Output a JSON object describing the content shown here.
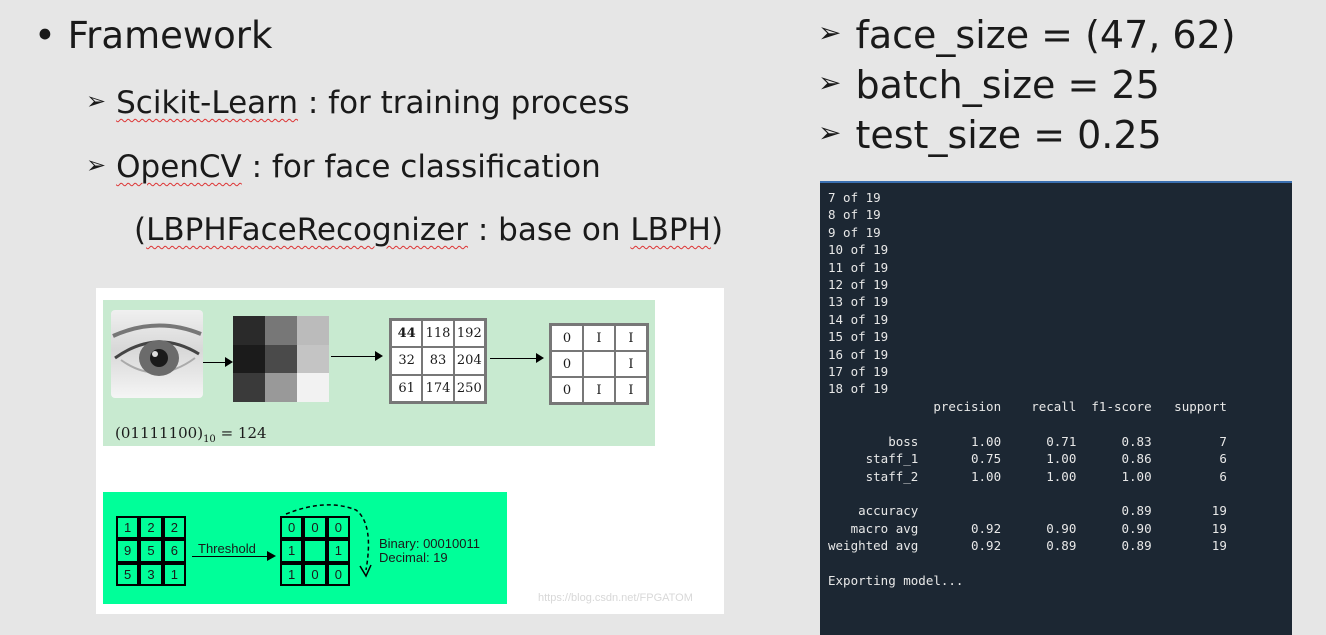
{
  "left": {
    "heading": "Framework",
    "bullet": "•",
    "arrow": "➢",
    "item1_link": "Scikit-Learn",
    "item1_rest": " : for training process",
    "item2_link": "OpenCV",
    "item2_rest": " : for face classification",
    "item3_open": "(",
    "item3_link": "LBPHFaceRecognizer",
    "item3_mid": " : base on ",
    "item3_link2": "LBPH",
    "item3_close": ")"
  },
  "params": [
    "face_size = (47, 62)",
    "batch_size = 25",
    "test_size = 0.25"
  ],
  "lbp_figure": {
    "matrix": [
      "44",
      "118",
      "192",
      "32",
      "83",
      "204",
      "61",
      "174",
      "250"
    ],
    "binary": [
      "0",
      "I",
      "I",
      "0",
      "",
      "I",
      "0",
      "I",
      "I"
    ],
    "formula_main": "(01111100)",
    "formula_sub": "10",
    "formula_eq": " = 124"
  },
  "threshold_figure": {
    "input": [
      "1",
      "2",
      "2",
      "9",
      "5",
      "6",
      "5",
      "3",
      "1"
    ],
    "arrow_label": "Threshold",
    "output": [
      "0",
      "0",
      "0",
      "1",
      "",
      "1",
      "1",
      "0",
      "0"
    ],
    "result_line1": "Binary: 00010011",
    "result_line2": "Decimal: 19",
    "watermark": "https://blog.csdn.net/FPGATOM"
  },
  "terminal_text": "7 of 19\n8 of 19\n9 of 19\n10 of 19\n11 of 19\n12 of 19\n13 of 19\n14 of 19\n15 of 19\n16 of 19\n17 of 19\n18 of 19\n              precision    recall  f1-score   support\n\n        boss       1.00      0.71      0.83         7\n     staff_1       0.75      1.00      0.86         6\n     staff_2       1.00      1.00      1.00         6\n\n    accuracy                           0.89        19\n   macro avg       0.92      0.90      0.90        19\nweighted avg       0.92      0.89      0.89        19\n\nExporting model..."
}
